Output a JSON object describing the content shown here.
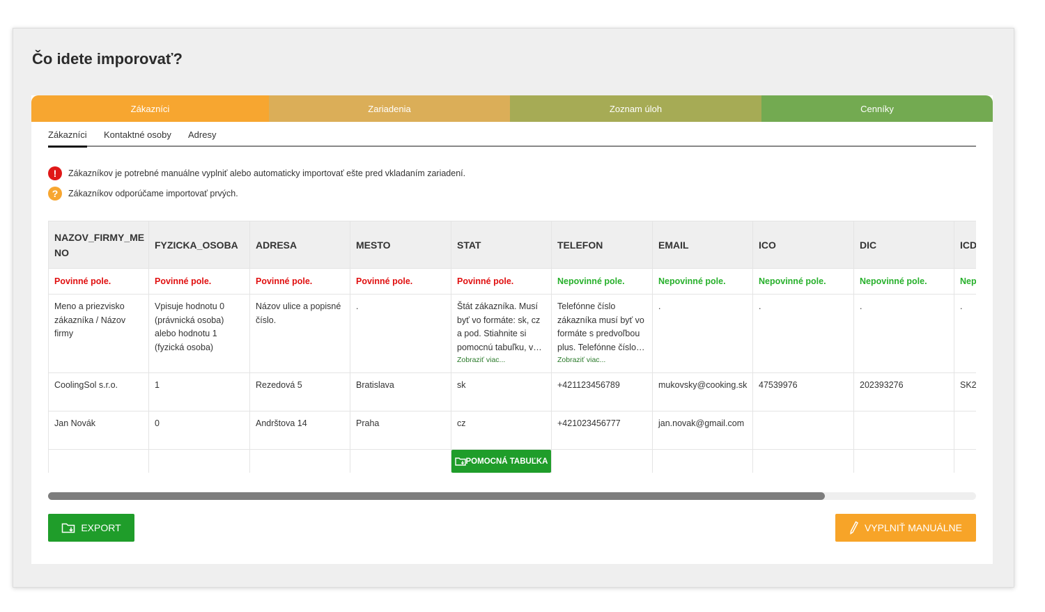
{
  "page": {
    "title": "Čo idete imporovať?"
  },
  "steps": [
    {
      "label": "Zákazníci",
      "color": "#f7a630"
    },
    {
      "label": "Zariadenia",
      "color": "#dbae58"
    },
    {
      "label": "Zoznam úloh",
      "color": "#a6ab55"
    },
    {
      "label": "Cenníky",
      "color": "#73aa51"
    }
  ],
  "subtabs": [
    "Zákazníci",
    "Kontaktné osoby",
    "Adresy"
  ],
  "notices": [
    {
      "icon": "!",
      "icon_name": "error-icon",
      "color": "#e01818",
      "text": "Zákazníkov je potrebné manuálne vyplniť alebo automaticky importovať ešte pred vkladaním zariadení."
    },
    {
      "icon": "?",
      "icon_name": "question-icon",
      "color": "#f7a630",
      "text": "Zákazníkov odporúčame importovať prvých."
    }
  ],
  "table": {
    "columns": [
      "NAZOV_FIRMY_ME NO",
      "FYZICKA_OSOBA",
      "ADRESA",
      "MESTO",
      "STAT",
      "TELEFON",
      "EMAIL",
      "ICO",
      "DIC",
      "ICD"
    ],
    "requirements": [
      "Povinné pole.",
      "Povinné pole.",
      "Povinné pole.",
      "Povinné pole.",
      "Povinné pole.",
      "Nepovinné pole.",
      "Nepovinné pole.",
      "Nepovinné pole.",
      "Nepovinné pole.",
      "Nep"
    ],
    "descriptions": [
      "Meno a priezvisko zákazníka / Názov firmy",
      "Vpisuje hodnotu 0 (právnická osoba) alebo hodnotu 1 (fyzická osoba)",
      "Názov ulice a popisné číslo.",
      ".",
      "Štát zákazníka. Musí byť vo formáte: sk, cz a pod. Stiahnite si pomocnú tabuľku, v…",
      "Telefónne číslo zákazníka musí byť vo formáte s predvoľbou plus. Telefónne číslo…",
      ".",
      ".",
      ".",
      "."
    ],
    "show_more": "Zobraziť viac...",
    "rows": [
      [
        "CoolingSol s.r.o.",
        "1",
        "Rezedová 5",
        "Bratislava",
        "sk",
        "+421123456789",
        "mukovsky@cooking.sk",
        "47539976",
        "202393276",
        "SK2"
      ],
      [
        "Jan Novák",
        "0",
        "Andrštova 14",
        "Praha",
        "cz",
        "+421023456777",
        "jan.novak@gmail.com",
        "",
        "",
        ""
      ]
    ],
    "help_button": "POMOCNÁ TABUĽKA"
  },
  "actions": {
    "export": "EXPORT",
    "manual": "VYPLNIŤ MANUÁLNE"
  }
}
